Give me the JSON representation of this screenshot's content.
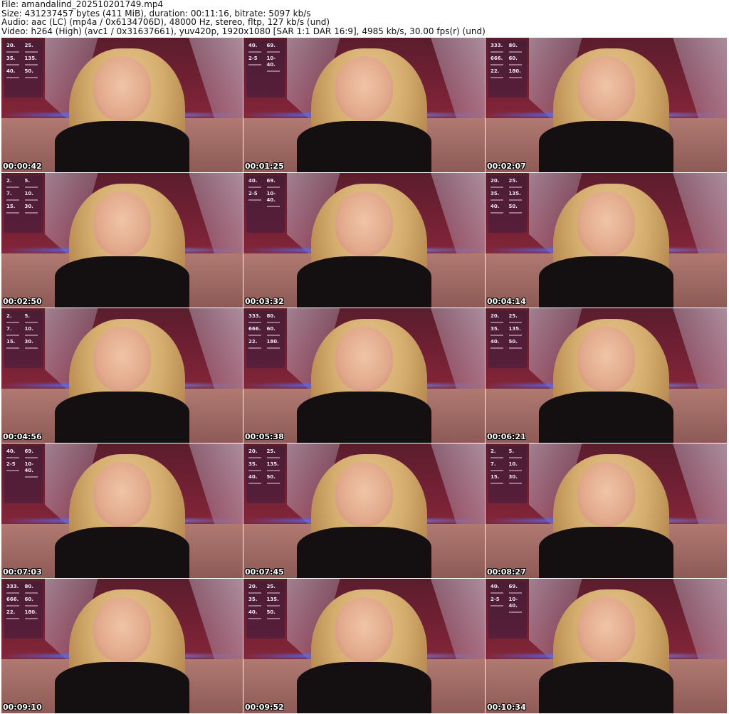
{
  "header": {
    "file": "File: amandalind_202510201749.mp4",
    "size": "Size: 431237457 bytes (411 MiB), duration: 00:11:16, bitrate: 5097 kb/s",
    "audio": "Audio: aac (LC) (mp4a / 0x6134706D), 48000 Hz, stereo, fltp, 127 kb/s (und)",
    "video": "Video: h264 (High) (avc1 / 0x31637661), yuv420p, 1920x1080 [SAR 1:1 DAR 16:9], 4985 kb/s, 30.00 fps(r) (und)"
  },
  "thumbnails": [
    {
      "timestamp": "00:00:42",
      "overlay": [
        "20.",
        "25.",
        "35.",
        "135.",
        "40.",
        "50."
      ]
    },
    {
      "timestamp": "00:01:25",
      "overlay": [
        "40.",
        "69.",
        "2-5",
        "10-40."
      ]
    },
    {
      "timestamp": "00:02:07",
      "overlay": [
        "333.",
        "80.",
        "666.",
        "60.",
        "22.",
        "180."
      ]
    },
    {
      "timestamp": "00:02:50",
      "overlay": [
        "2.",
        "5.",
        "7.",
        "10.",
        "15.",
        "30."
      ]
    },
    {
      "timestamp": "00:03:32",
      "overlay": [
        "40.",
        "69.",
        "2-5",
        "10-40."
      ]
    },
    {
      "timestamp": "00:04:14",
      "overlay": [
        "20.",
        "25.",
        "35.",
        "135.",
        "40.",
        "50."
      ]
    },
    {
      "timestamp": "00:04:56",
      "overlay": [
        "2.",
        "5.",
        "7.",
        "10.",
        "15.",
        "30."
      ]
    },
    {
      "timestamp": "00:05:38",
      "overlay": [
        "333.",
        "80.",
        "666.",
        "60.",
        "22.",
        "180."
      ]
    },
    {
      "timestamp": "00:06:21",
      "overlay": [
        "20.",
        "25.",
        "35.",
        "135.",
        "40.",
        "50."
      ]
    },
    {
      "timestamp": "00:07:03",
      "overlay": [
        "40.",
        "69.",
        "2-5",
        "10-40."
      ]
    },
    {
      "timestamp": "00:07:45",
      "overlay": [
        "20.",
        "25.",
        "35.",
        "135.",
        "40.",
        "50."
      ]
    },
    {
      "timestamp": "00:08:27",
      "overlay": [
        "2.",
        "5.",
        "7.",
        "10.",
        "15.",
        "30."
      ]
    },
    {
      "timestamp": "00:09:10",
      "overlay": [
        "333.",
        "80.",
        "666.",
        "60.",
        "22.",
        "180."
      ]
    },
    {
      "timestamp": "00:09:52",
      "overlay": [
        "20.",
        "25.",
        "35.",
        "135.",
        "40.",
        "50."
      ]
    },
    {
      "timestamp": "00:10:34",
      "overlay": [
        "40.",
        "69.",
        "2-5",
        "10-40."
      ]
    }
  ]
}
